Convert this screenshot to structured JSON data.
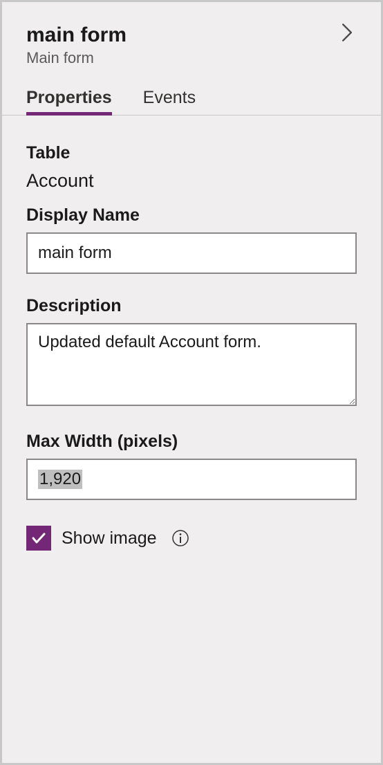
{
  "header": {
    "title": "main form",
    "subtitle": "Main form"
  },
  "tabs": {
    "properties": "Properties",
    "events": "Events"
  },
  "fields": {
    "table": {
      "label": "Table",
      "value": "Account"
    },
    "displayName": {
      "label": "Display Name",
      "value": "main form"
    },
    "description": {
      "label": "Description",
      "value": "Updated default Account form."
    },
    "maxWidth": {
      "label": "Max Width (pixels)",
      "value": "1,920"
    },
    "showImage": {
      "label": "Show image",
      "checked": true
    }
  },
  "colors": {
    "accent": "#742774"
  }
}
